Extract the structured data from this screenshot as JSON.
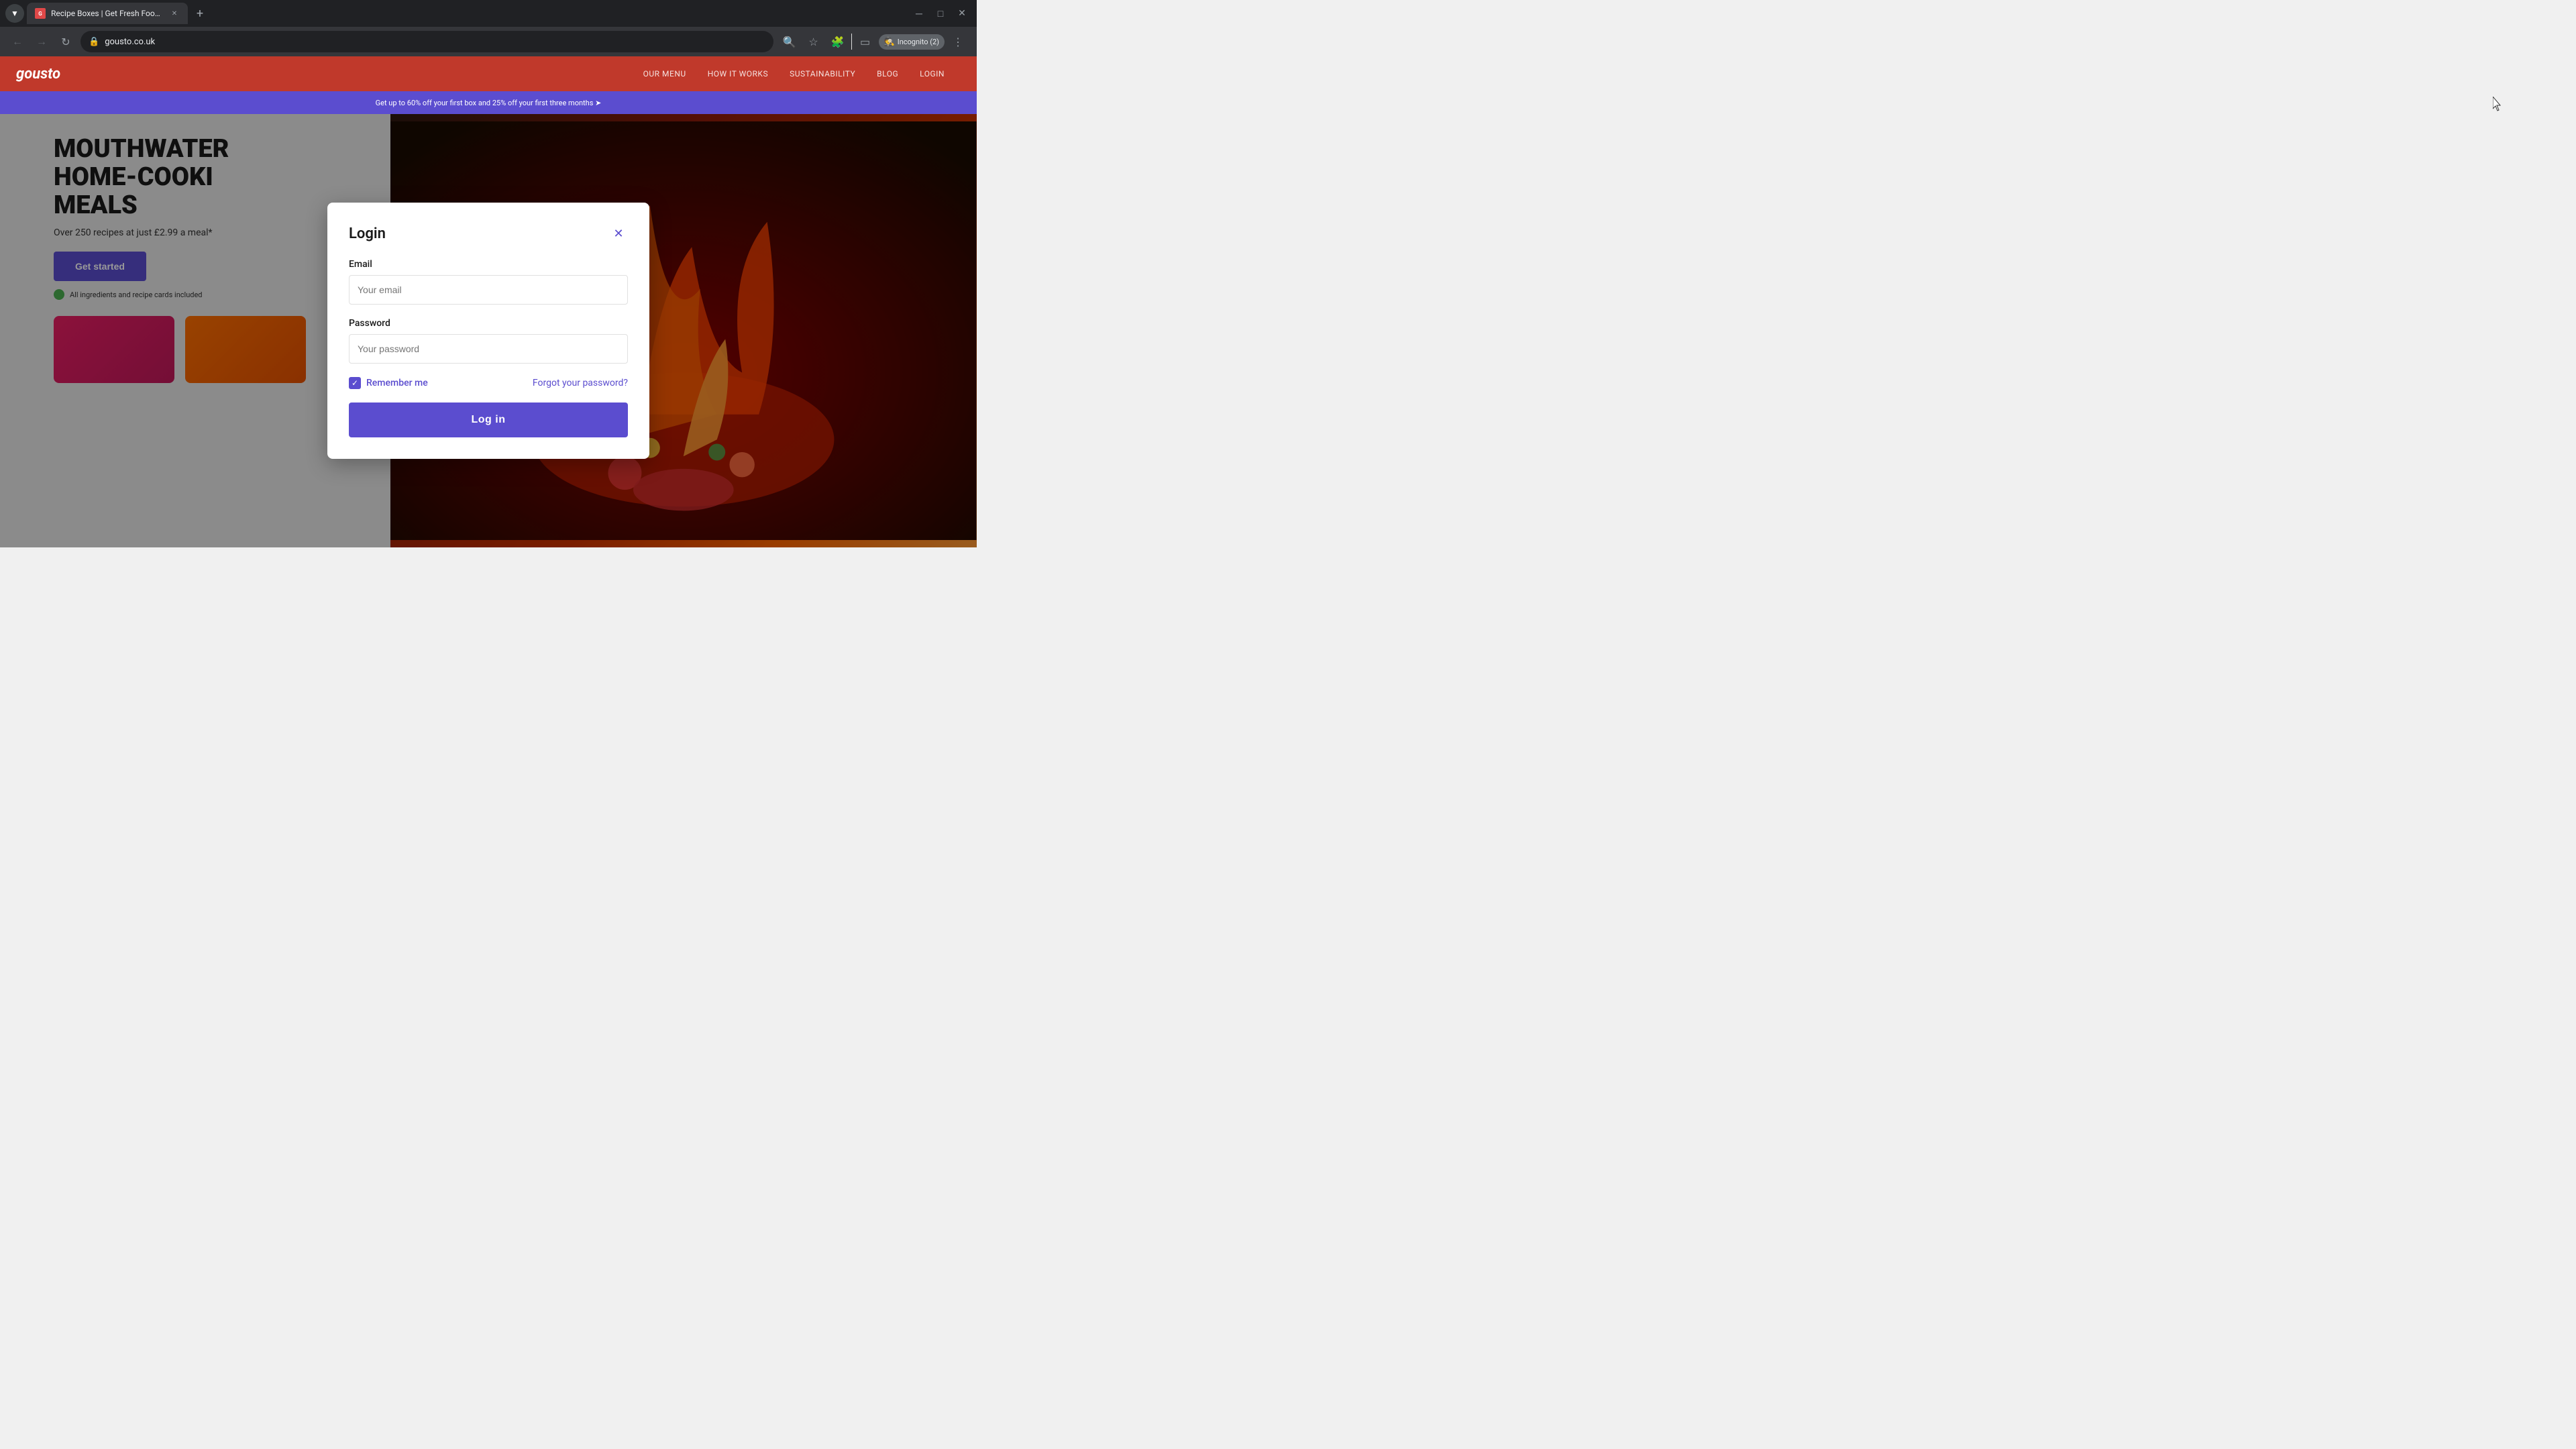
{
  "browser": {
    "tab_title": "Recipe Boxes | Get Fresh Food ...",
    "tab_favicon": "G",
    "url": "gousto.co.uk",
    "incognito_label": "Incognito (2)",
    "new_tab_label": "+",
    "back_disabled": false,
    "forward_disabled": true
  },
  "site": {
    "logo": "gousto",
    "nav": {
      "item1": "OUR MENU",
      "item2": "HOW IT WORKS",
      "item3": "SUSTAINABILITY",
      "item4": "BLOG",
      "item5": "LOGIN"
    },
    "promo_bar": "Get up to 60% off your first box and 25% off your first three months ➤",
    "hero": {
      "title_line1": "MOUTHWATER",
      "title_line2": "HOME-COOKI",
      "title_line3": "MEALS",
      "subtitle": "Over 250 recipes at just £2.99 a meal*",
      "cta": "Get started",
      "badge_text": "All ingredients and recipe cards included"
    }
  },
  "modal": {
    "title": "Login",
    "close_label": "✕",
    "email_label": "Email",
    "email_placeholder": "Your email",
    "password_label": "Password",
    "password_placeholder": "Your password",
    "remember_label": "Remember me",
    "forgot_label": "Forgot your password?",
    "login_btn": "Log in"
  }
}
